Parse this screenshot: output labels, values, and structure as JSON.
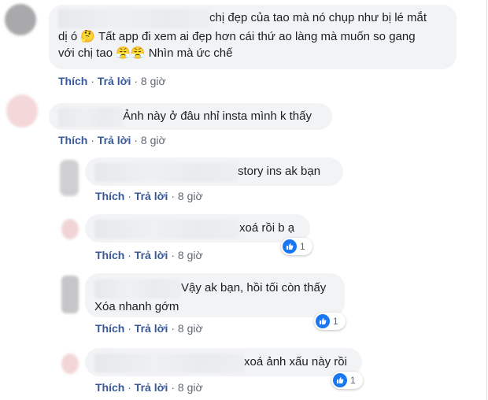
{
  "action_labels": {
    "like": "Thích",
    "reply": "Trả lời",
    "separator": "·"
  },
  "colors": {
    "link": "#385898",
    "bubble": "#f2f3f5",
    "like_badge": "#1877f2"
  },
  "comments": [
    {
      "line1": "chị đẹp của tao mà nó chụp như bị lé mắt",
      "line2": "dị ó",
      "line2_rest": " Tất app đi xem ai đẹp hơn cái thứ ao làng mà muốn so gang",
      "line3": "với chị tao",
      "line3_rest": " Nhìn mà ức chế",
      "emoji_1": "🤔",
      "emoji_2": "😤",
      "emoji_3": "😤",
      "time": "8 giờ"
    },
    {
      "text": "Ảnh này ở đâu nhỉ insta mình k thấy",
      "time": "8 giờ"
    },
    {
      "text": "story ins ak bạn",
      "time": "8 giờ"
    },
    {
      "text": "xoá rồi b ạ",
      "time": "8 giờ",
      "reaction_count": "1"
    },
    {
      "line1": "Vậy ak bạn, hồi tối còn thấy",
      "line2": "Xóa nhanh gớm",
      "time": "8 giờ",
      "reaction_count": "1"
    },
    {
      "text": "xoá ảnh xấu này rồi",
      "time": "8 giờ",
      "reaction_count": "1"
    }
  ]
}
